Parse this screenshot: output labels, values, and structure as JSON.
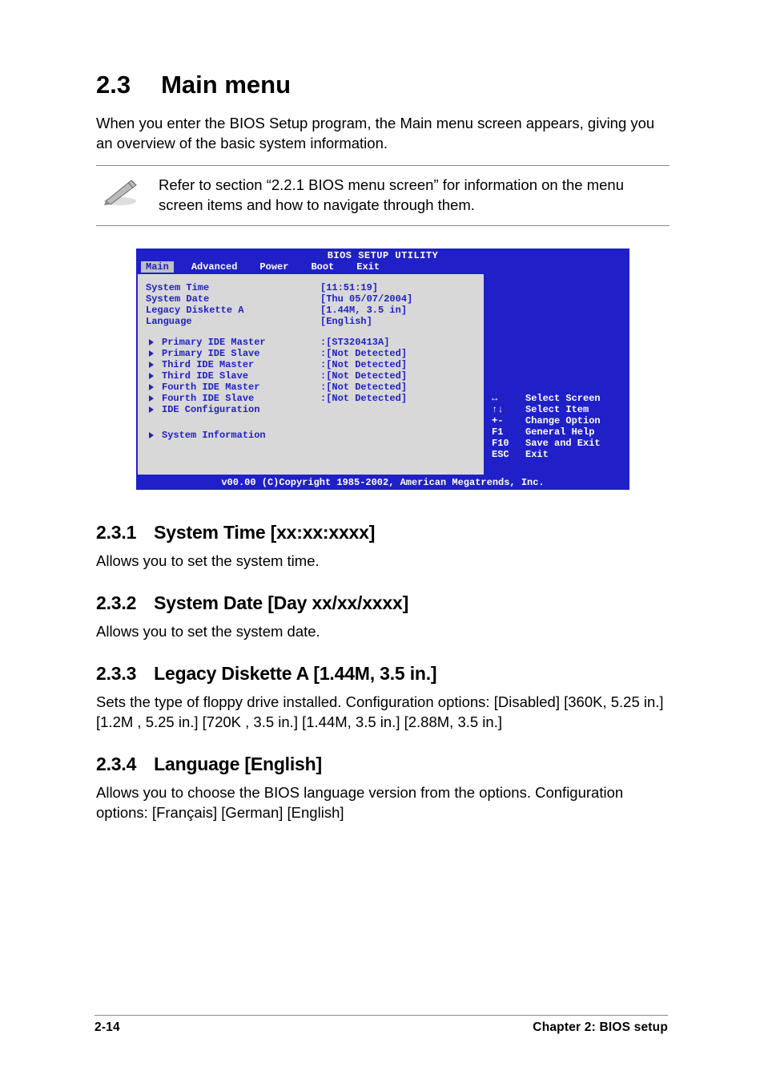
{
  "heading": {
    "num": "2.3",
    "title": "Main menu"
  },
  "intro": "When you enter the BIOS Setup program, the Main menu screen appears, giving you an overview of the basic system information.",
  "note": "Refer to section “2.2.1  BIOS menu screen” for information on the menu screen items and how to navigate through them.",
  "bios": {
    "title": "BIOS SETUP UTILITY",
    "tabs": {
      "selected": "Main",
      "others": [
        "Advanced",
        "Power",
        "Boot",
        "Exit"
      ]
    },
    "top_rows": [
      {
        "label": "System Time",
        "value": "[11:51:19]"
      },
      {
        "label": "System Date",
        "value": "[Thu 05/07/2004]"
      },
      {
        "label": "Legacy Diskette A",
        "value": "[1.44M, 3.5 in]"
      },
      {
        "label": "Language",
        "value": "[English]"
      }
    ],
    "sub_rows": [
      {
        "label": "Primary IDE Master",
        "value": ":[ST320413A]"
      },
      {
        "label": "Primary IDE Slave",
        "value": ":[Not Detected]"
      },
      {
        "label": "Third IDE Master",
        "value": ":[Not Detected]"
      },
      {
        "label": "Third IDE Slave",
        "value": ":[Not Detected]"
      },
      {
        "label": "Fourth IDE Master",
        "value": ":[Not Detected]"
      },
      {
        "label": "Fourth IDE Slave",
        "value": ":[Not Detected]"
      },
      {
        "label": "IDE Configuration",
        "value": ""
      }
    ],
    "sysinfo": "System Information",
    "help": [
      {
        "k": "↔",
        "d": "Select Screen"
      },
      {
        "k": "↑↓",
        "d": "Select Item"
      },
      {
        "k": "+-",
        "d": "Change Option"
      },
      {
        "k": "F1",
        "d": "General Help"
      },
      {
        "k": "F10",
        "d": "Save and Exit"
      },
      {
        "k": "ESC",
        "d": "Exit"
      }
    ],
    "footer": "v00.00 (C)Copyright 1985-2002, American Megatrends, Inc."
  },
  "subs": [
    {
      "num": "2.3.1",
      "title": "System Time [xx:xx:xxxx]",
      "body": "Allows you to set the system time."
    },
    {
      "num": "2.3.2",
      "title": "System Date [Day xx/xx/xxxx]",
      "body": "Allows you to set the system date."
    },
    {
      "num": "2.3.3",
      "title": "Legacy Diskette A [1.44M, 3.5 in.]",
      "body": "Sets the type of floppy drive installed. Configuration options: [Disabled] [360K, 5.25 in.] [1.2M , 5.25 in.] [720K , 3.5 in.] [1.44M, 3.5 in.] [2.88M, 3.5 in.]"
    },
    {
      "num": "2.3.4",
      "title": "Language [English]",
      "body": "Allows you to choose the BIOS language version from the options. Configuration options: [Français] [German] [English]"
    }
  ],
  "footer": {
    "left": "2-14",
    "right": "Chapter 2: BIOS setup"
  }
}
